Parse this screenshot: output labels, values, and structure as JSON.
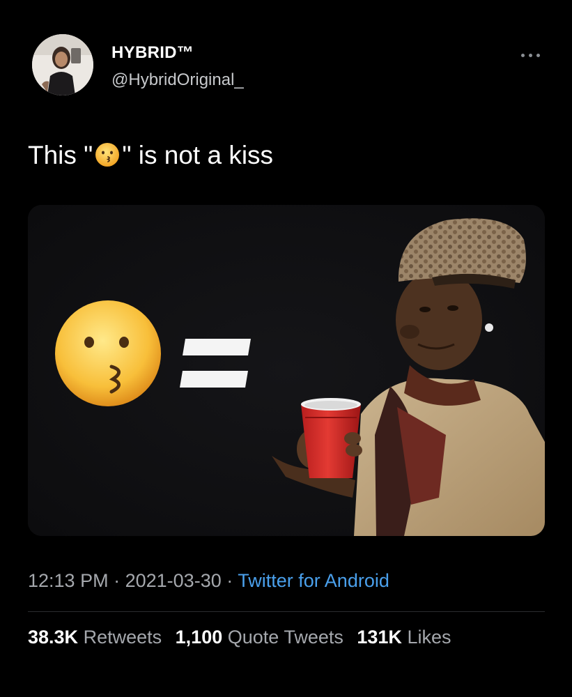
{
  "user": {
    "display_name": "HYBRID™",
    "handle": "@HybridOriginal_"
  },
  "tweet": {
    "text_before": "This \"",
    "emoji_icon": "kissing-face-emoji",
    "text_after": "\" is not a kiss"
  },
  "media": {
    "left_icon": "kissing-face-emoji",
    "middle_icon": "equals-sign-icon"
  },
  "meta": {
    "time": "12:13 PM",
    "separator": "·",
    "date": "2021-03-30",
    "source": "Twitter for Android"
  },
  "stats": [
    {
      "count": "38.3K",
      "label": "Retweets"
    },
    {
      "count": "1,100",
      "label": "Quote Tweets"
    },
    {
      "count": "131K",
      "label": "Likes"
    }
  ],
  "colors": {
    "background": "#000000",
    "link": "#4aa0ec",
    "secondary_text": "#a5a8ad"
  }
}
